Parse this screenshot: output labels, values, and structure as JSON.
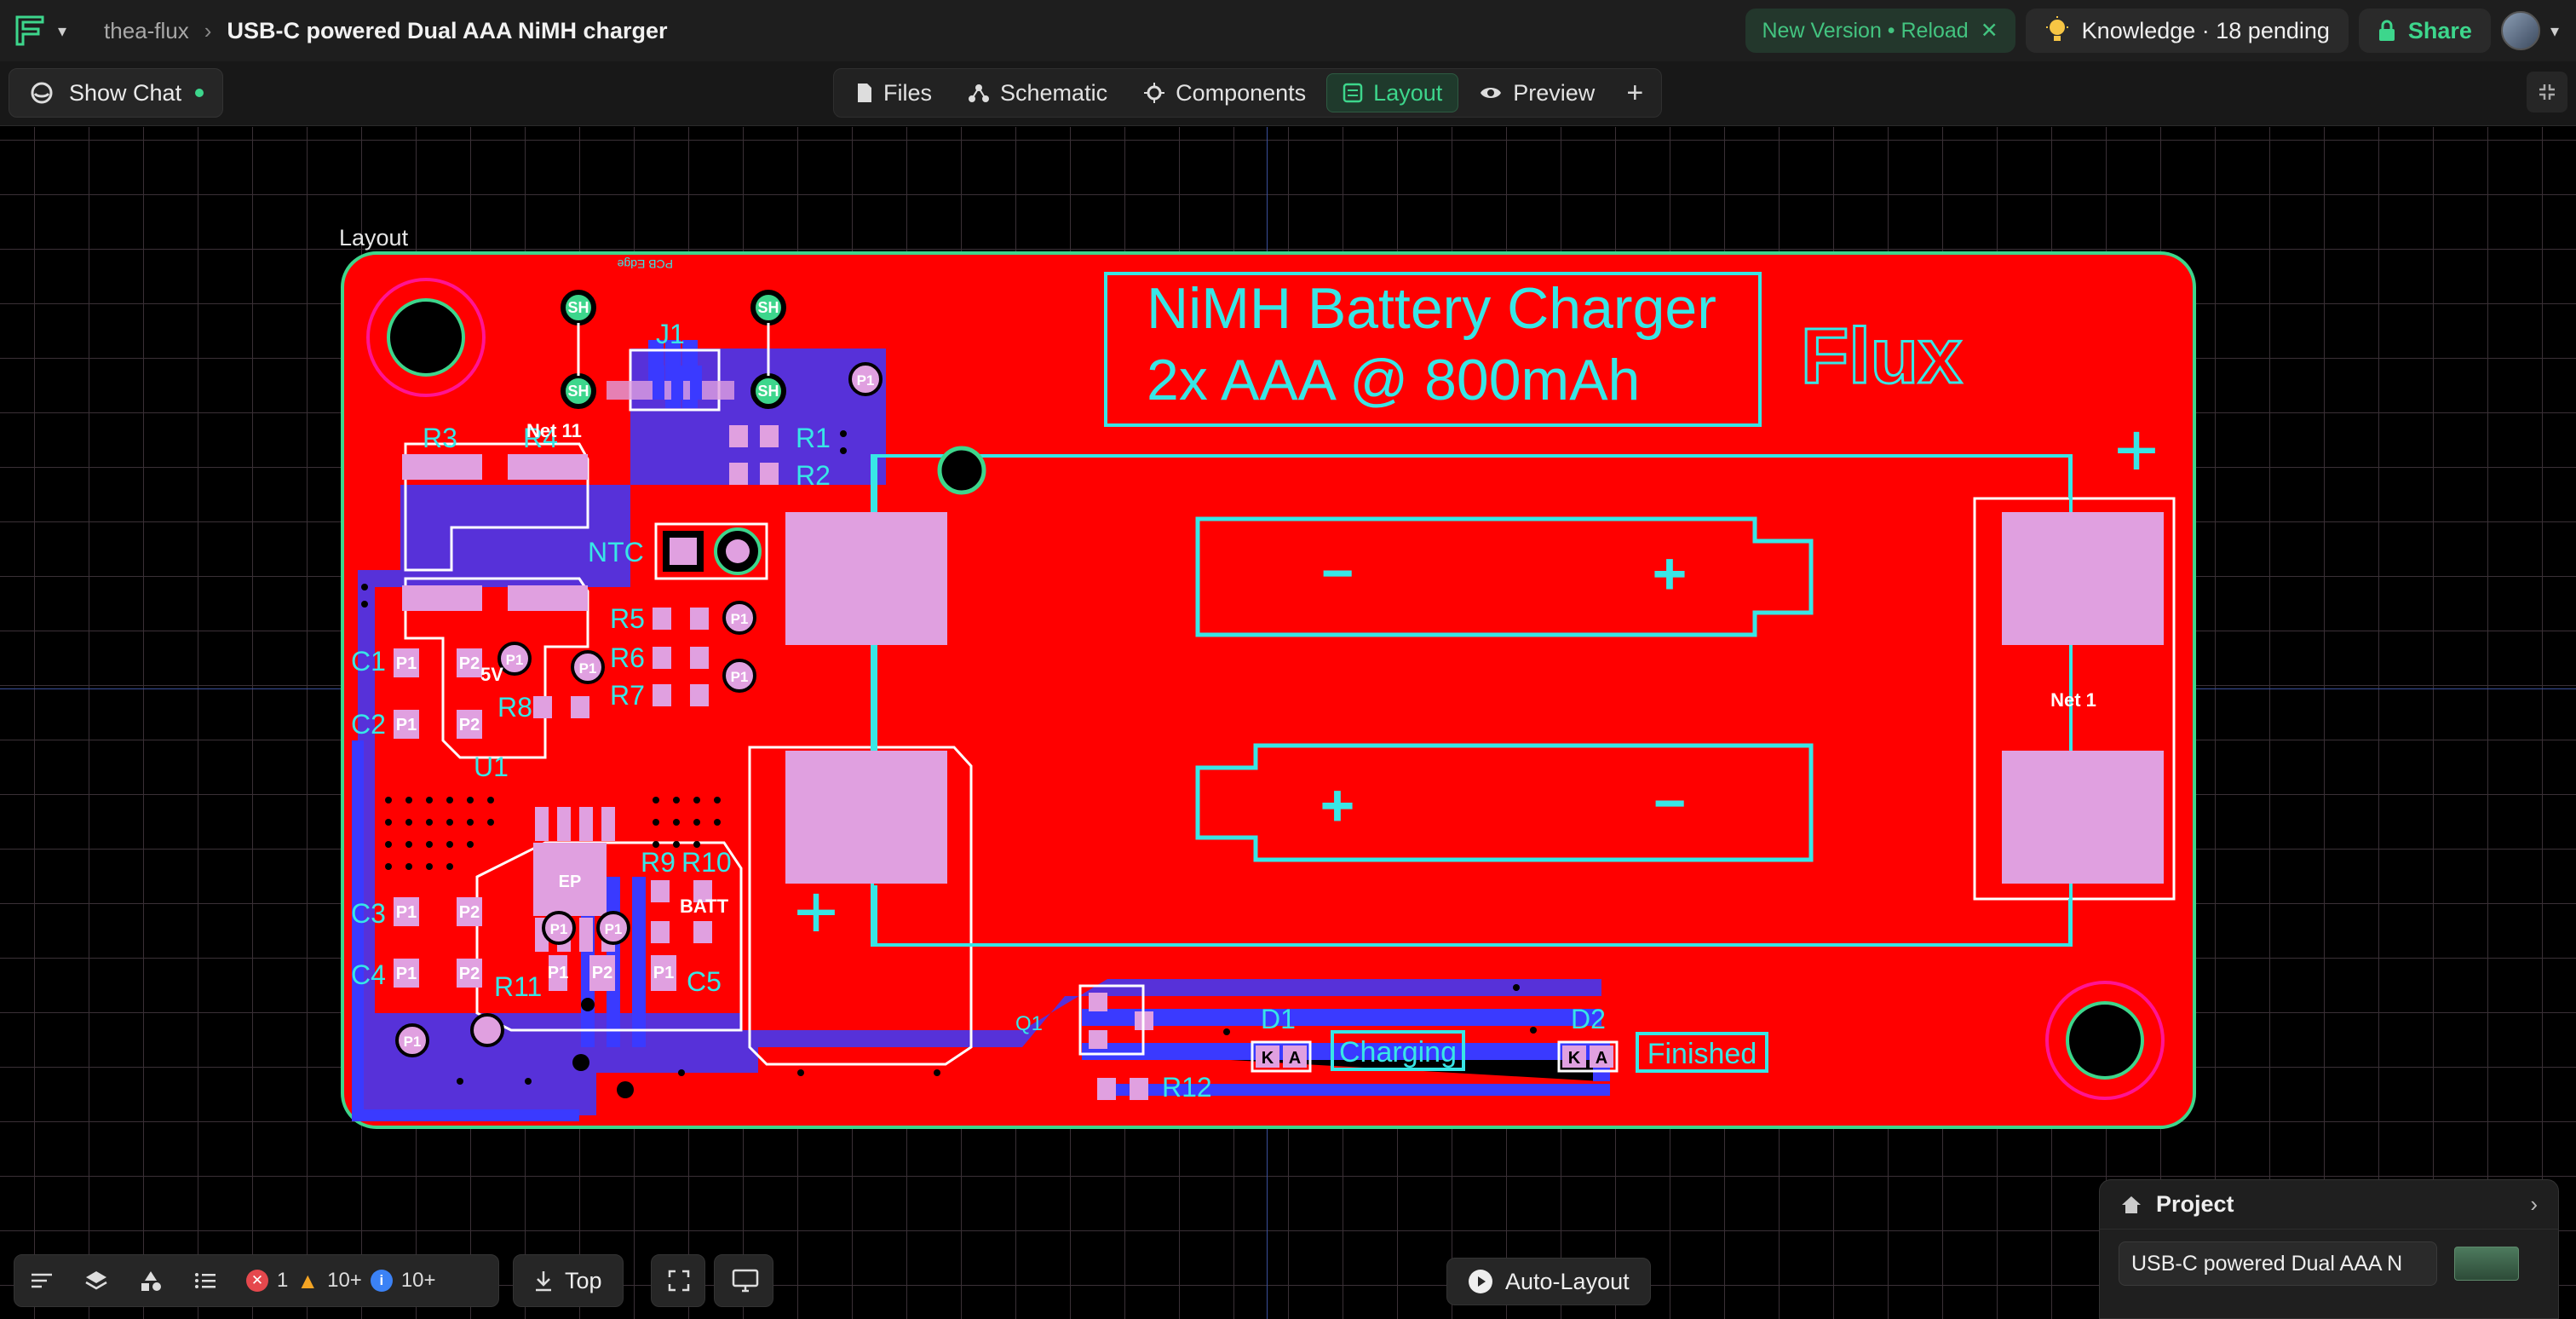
{
  "header": {
    "user": "thea-flux",
    "project_title": "USB-C powered Dual AAA NiMH charger",
    "version_notice": "New Version • Reload",
    "knowledge": "Knowledge · 18 pending",
    "share": "Share"
  },
  "toolbar": {
    "show_chat": "Show Chat",
    "tabs": [
      {
        "label": "Files",
        "icon": "file-icon"
      },
      {
        "label": "Schematic",
        "icon": "schematic-icon"
      },
      {
        "label": "Components",
        "icon": "chip-icon"
      },
      {
        "label": "Layout",
        "icon": "layout-icon",
        "active": true
      },
      {
        "label": "Preview",
        "icon": "eye-icon"
      }
    ]
  },
  "canvas": {
    "layout_label": "Layout",
    "pcb_edge_label": "PCB Edge",
    "title_line1": "NiMH Battery Charger",
    "title_line2": "2x AAA @ 800mAh",
    "brand": "Flux",
    "net1": "Net 1",
    "net11": "Net 11",
    "charging": "Charging",
    "finished": "Finished",
    "designators": [
      "J1",
      "R1",
      "R2",
      "R3",
      "R4",
      "NTC",
      "R5",
      "R6",
      "R7",
      "R8",
      "C1",
      "C2",
      "U1",
      "C3",
      "C4",
      "R9",
      "R10",
      "R11",
      "C5",
      "Q1",
      "D1",
      "D2",
      "R12"
    ],
    "pad_labels": [
      "P1",
      "P2",
      "SH",
      "EP",
      "K",
      "A",
      "BATT",
      "5V"
    ],
    "battery_symbols": {
      "minus": "−",
      "plus": "+"
    }
  },
  "bottom": {
    "errors": "1",
    "warnings": "10+",
    "infos": "10+",
    "side": "Top",
    "auto_layout": "Auto-Layout"
  },
  "project_panel": {
    "heading": "Project",
    "name": "USB-C powered Dual AAA N"
  },
  "colors": {
    "board_red": "#ff0000",
    "silkscreen_cyan": "#38e6e6",
    "pad_pink": "#e0a0e0",
    "trace_blue": "#3a3aff",
    "accent_green": "#3dd68c"
  }
}
